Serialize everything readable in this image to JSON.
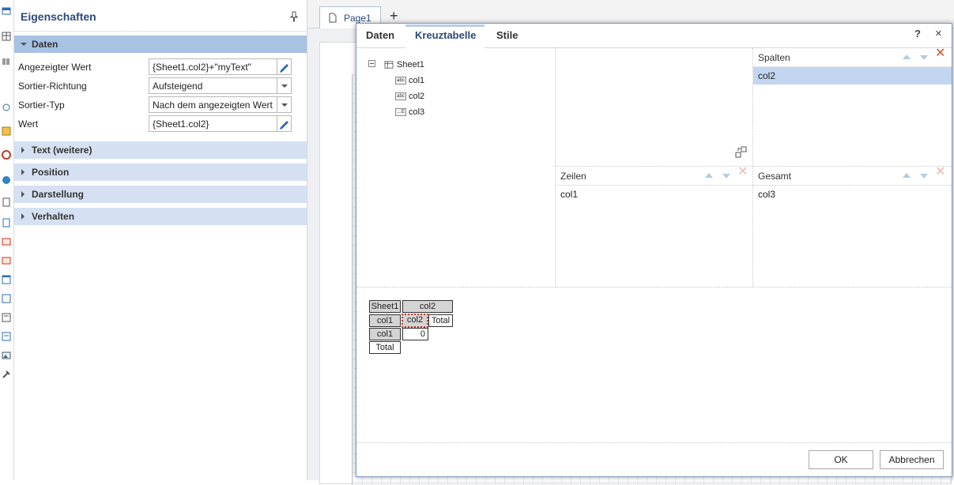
{
  "properties": {
    "title": "Eigenschaften",
    "categories": [
      {
        "label": "Daten",
        "expanded": true
      },
      {
        "label": "Text (weitere)",
        "expanded": false
      },
      {
        "label": "Position",
        "expanded": false
      },
      {
        "label": "Darstellung",
        "expanded": false
      },
      {
        "label": "Verhalten",
        "expanded": false
      }
    ],
    "rows": [
      {
        "label": "Angezeigter Wert",
        "value": "{Sheet1.col2}+\"myText\""
      },
      {
        "label": "Sortier-Richtung",
        "value": "Aufsteigend"
      },
      {
        "label": "Sortier-Typ",
        "value": "Nach dem angezeigten Wert"
      },
      {
        "label": "Wert",
        "value": "{Sheet1.col2}"
      }
    ]
  },
  "designer": {
    "page_tab": "Page1",
    "add_tab": "+"
  },
  "dialog": {
    "tabs": [
      "Daten",
      "Kreuztabelle",
      "Stile"
    ],
    "active_tab": "Kreuztabelle",
    "help": "?",
    "close": "×",
    "tree": {
      "root": "Sheet1",
      "fields": [
        {
          "name": "col1",
          "type": "abc"
        },
        {
          "name": "col2",
          "type": "abc"
        },
        {
          "name": "col3",
          "type": "…E"
        }
      ]
    },
    "spalten": {
      "title": "Spalten",
      "items": [
        "col2"
      ]
    },
    "zeilen": {
      "title": "Zeilen",
      "items": [
        "col1"
      ]
    },
    "gesamt": {
      "title": "Gesamt",
      "items": [
        "col3"
      ]
    },
    "preview": {
      "corner": "Sheet1",
      "col_header": "col2",
      "row_field": "col1",
      "col_field": "col2",
      "col_total": "Total",
      "row_value": "col1",
      "cell_value": "0",
      "row_total": "Total"
    },
    "buttons": {
      "ok": "OK",
      "cancel": "Abbrechen"
    }
  },
  "colors": {
    "accent": "#2b4a7a",
    "category_bg": "#d5e1f2",
    "selected": "#c3d6f1",
    "remove": "#d8502c"
  }
}
